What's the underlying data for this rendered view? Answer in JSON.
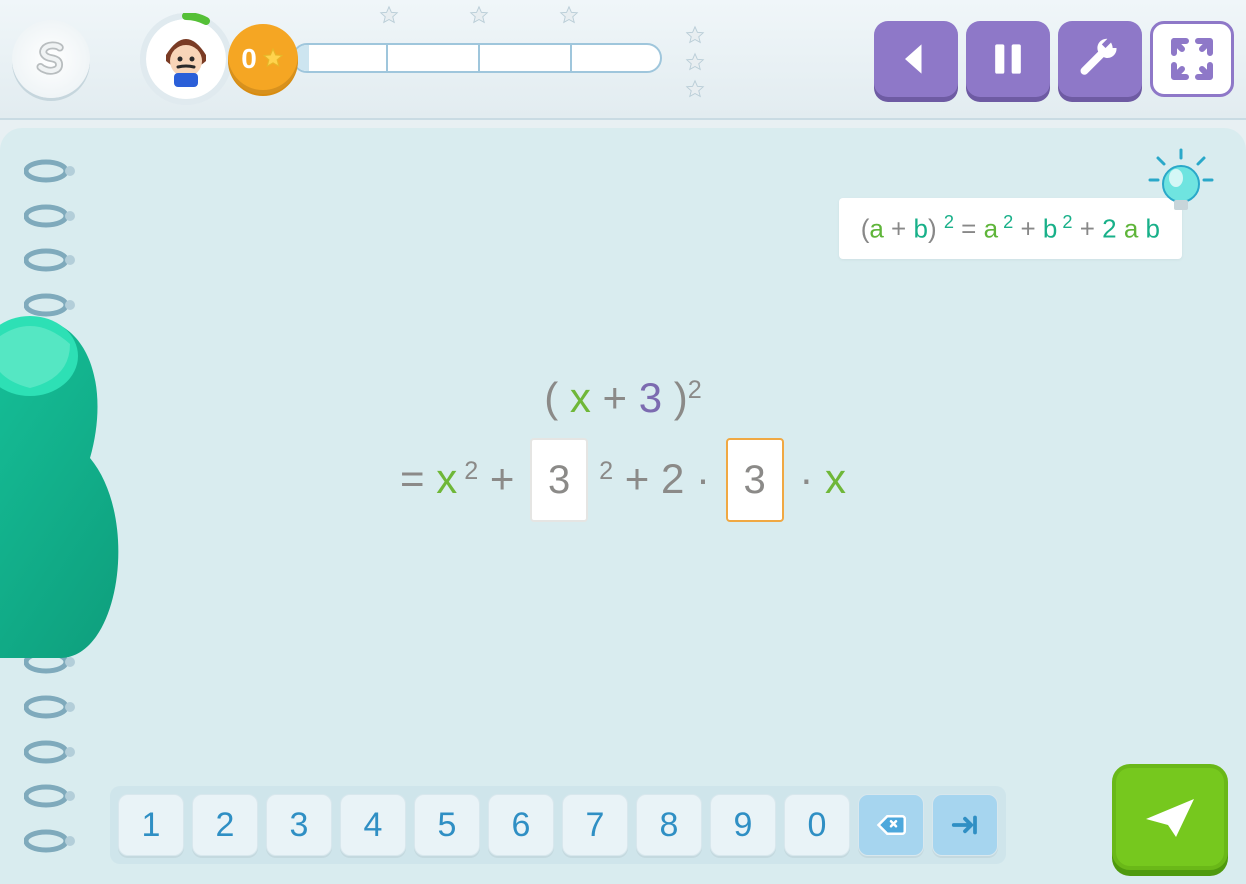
{
  "header": {
    "score": "0"
  },
  "hint": {
    "lhs_open": "(",
    "a": "a",
    "plus": " + ",
    "b": "b",
    "close": ") ",
    "sq": "2",
    "eq": " = ",
    "a2_a": "a",
    "a2_sup": " 2",
    "plus2": " + ",
    "b2_b": "b",
    "b2_sup": " 2",
    "plus3": " + ",
    "two": "2 ",
    "a3": "a ",
    "b3": "b"
  },
  "equation": {
    "line1": {
      "open": "( ",
      "x": "x",
      "plus": " + ",
      "three": "3",
      "close": " )",
      "sup": "2"
    },
    "line2": {
      "eq": "= ",
      "x": "x",
      "sup1": " 2",
      "plus1": " + ",
      "box1": "3",
      "sup2": " 2",
      "plus2": " + ",
      "two": "2",
      "dot1": " · ",
      "box2": "3",
      "dot2": " · ",
      "x2": "x"
    }
  },
  "keypad": [
    "1",
    "2",
    "3",
    "4",
    "5",
    "6",
    "7",
    "8",
    "9",
    "0"
  ]
}
